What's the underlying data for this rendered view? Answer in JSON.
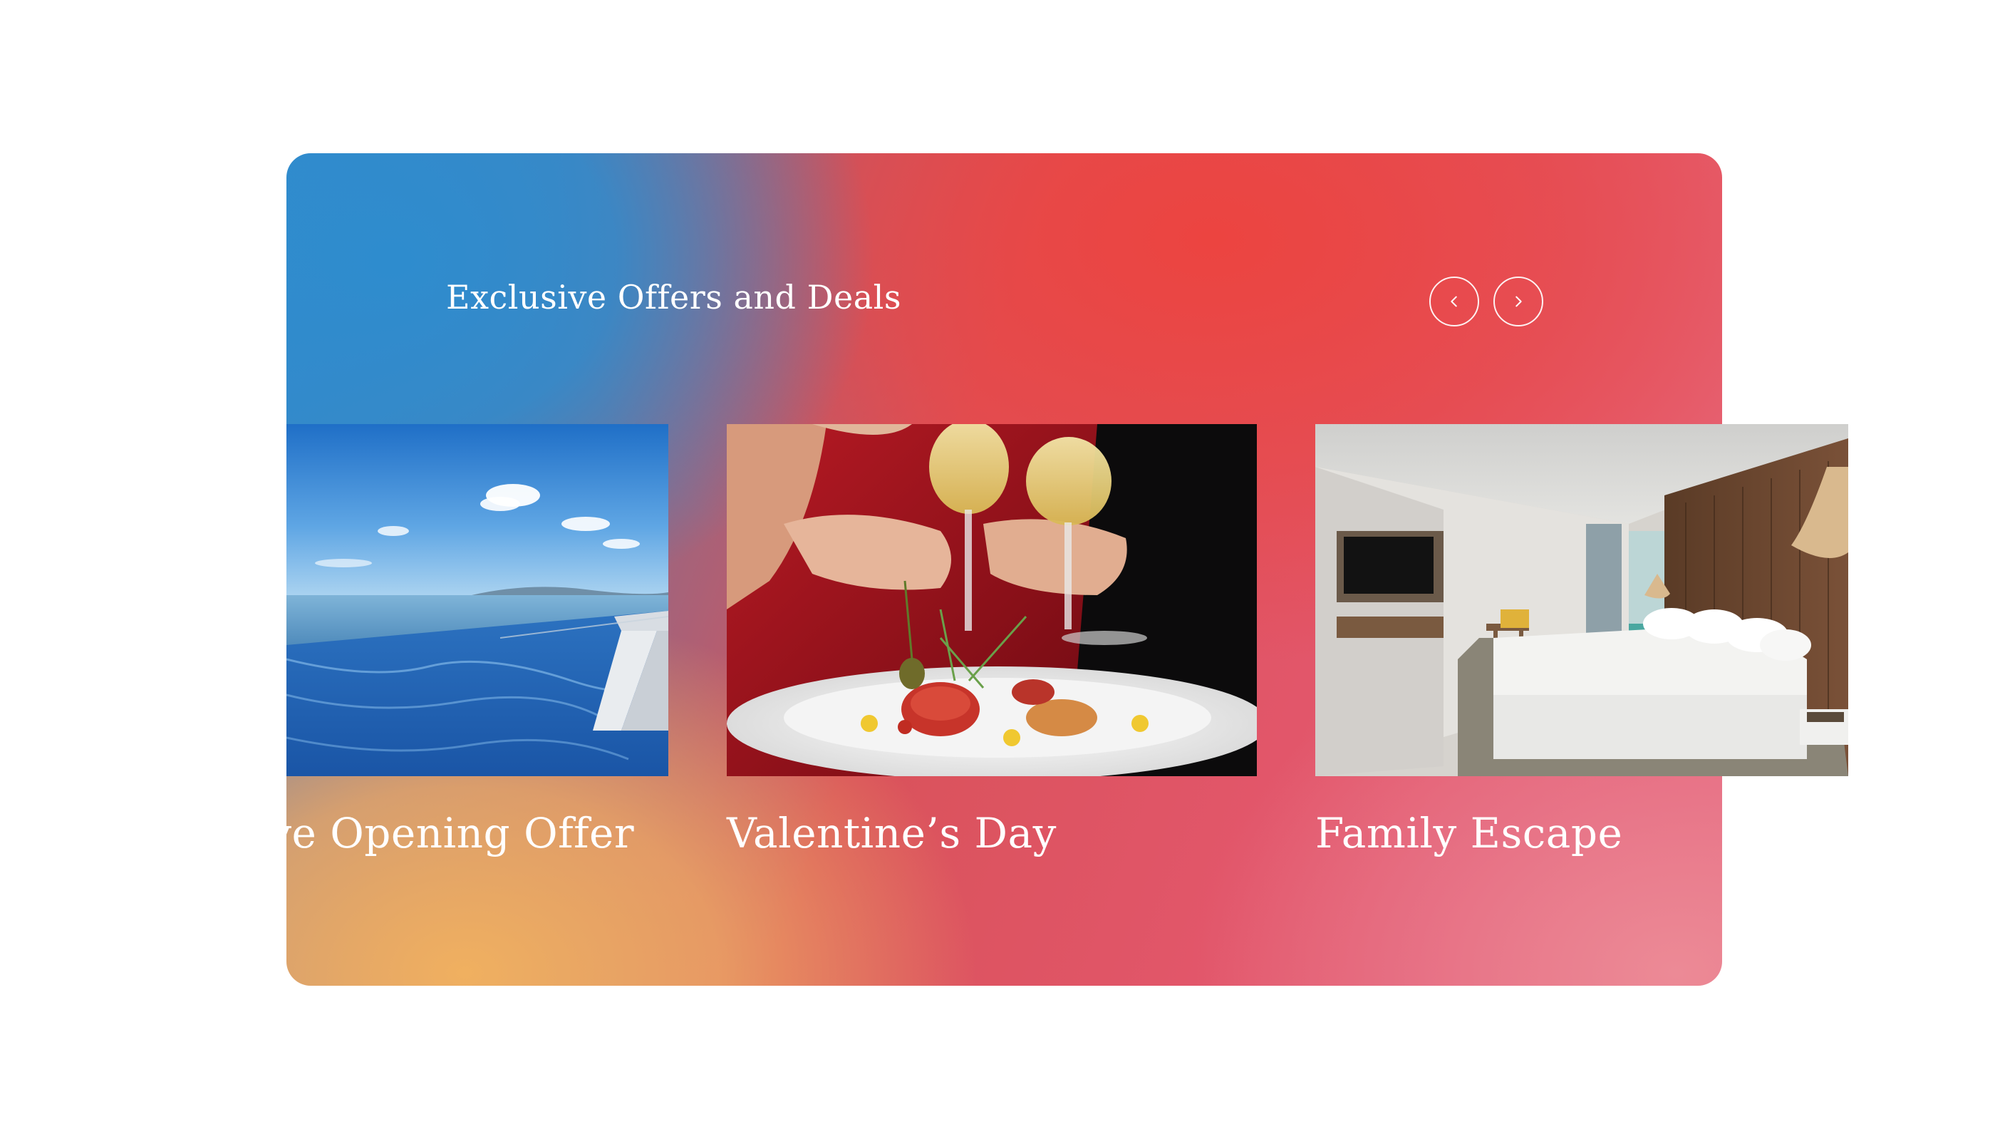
{
  "section": {
    "title": "Exclusive Offers and Deals"
  },
  "navigation": {
    "prev_icon": "chevron-left-icon",
    "next_icon": "chevron-right-icon"
  },
  "offers": [
    {
      "title": "lusive Opening Offer",
      "image": "infinity-pool-ocean"
    },
    {
      "title": "Valentine’s Day",
      "image": "wine-toast-dinner-plate"
    },
    {
      "title": "Family Escape",
      "image": "hotel-bedroom"
    }
  ],
  "colors": {
    "gradient_blue": "#2e8cce",
    "gradient_red": "#ec4440",
    "gradient_orange": "#f0b060",
    "gradient_pink": "#ec8a96",
    "text": "#ffffff"
  }
}
